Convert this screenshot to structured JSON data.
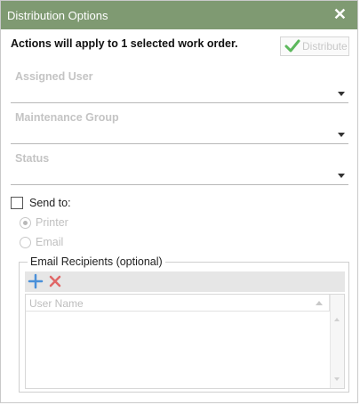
{
  "dialog": {
    "title": "Distribution Options",
    "close_glyph": "✕"
  },
  "summary": "Actions will apply to 1 selected work order.",
  "distribute_button": {
    "label": "Distribute",
    "icon": "checkmark-icon",
    "enabled": false
  },
  "fields": {
    "assigned_user": {
      "label": "Assigned User",
      "value": ""
    },
    "maintenance_group": {
      "label": "Maintenance Group",
      "value": ""
    },
    "status": {
      "label": "Status",
      "value": ""
    }
  },
  "send_to": {
    "label": "Send to:",
    "checked": false,
    "options": [
      {
        "label": "Printer",
        "selected": true,
        "enabled": false
      },
      {
        "label": "Email",
        "selected": false,
        "enabled": false
      }
    ]
  },
  "email_recipients": {
    "legend": "Email Recipients (optional)",
    "toolbar": [
      {
        "name": "add-icon",
        "color": "#4a90d9"
      },
      {
        "name": "remove-icon",
        "color": "#e06666"
      }
    ],
    "columns": [
      "User Name"
    ],
    "rows": []
  },
  "colors": {
    "titlebar": "#7f9a72",
    "accent_check": "#5cb85c"
  }
}
